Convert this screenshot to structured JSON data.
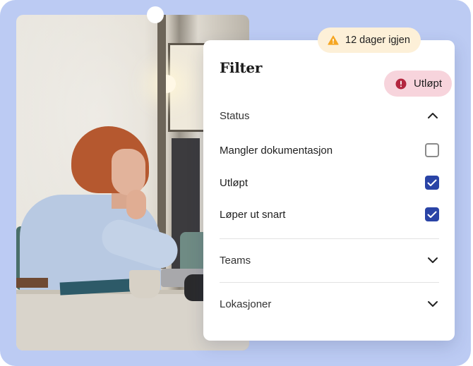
{
  "panel": {
    "title": "Filter",
    "status_section": {
      "label": "Status",
      "expanded": true,
      "options": [
        {
          "label": "Mangler dokumentasjon",
          "checked": false
        },
        {
          "label": "Utløpt",
          "checked": true
        },
        {
          "label": "Løper ut snart",
          "checked": true
        }
      ]
    },
    "teams_section": {
      "label": "Teams",
      "expanded": false
    },
    "locations_section": {
      "label": "Lokasjoner",
      "expanded": false
    }
  },
  "badges": {
    "days_left": {
      "text": "12 dager igjen",
      "icon": "warning-icon",
      "color": "#f5a623"
    },
    "expired": {
      "text": "Utløpt",
      "icon": "alert-circle-icon",
      "color": "#b3263f"
    }
  },
  "colors": {
    "background": "#bccbf3",
    "checkbox_checked": "#2a44a6",
    "badge_warning_bg": "#fdf0d8",
    "badge_error_bg": "#f7d4dc"
  }
}
